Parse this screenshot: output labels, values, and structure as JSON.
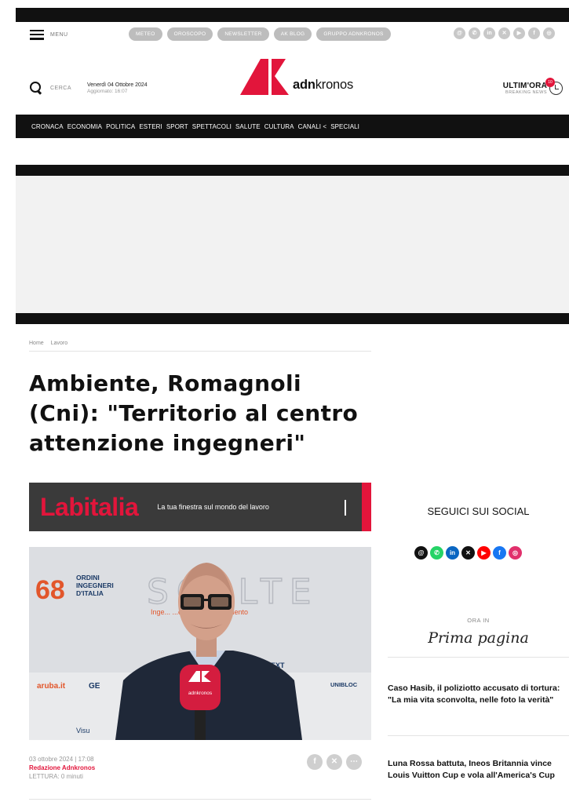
{
  "header": {
    "menu_label": "MENU",
    "pills": [
      "METEO",
      "OROSCOPO",
      "NEWSLETTER",
      "AK BLOG",
      "GRUPPO ADNKRONOS"
    ],
    "top_socials": [
      "threads-icon",
      "whatsapp-icon",
      "linkedin-icon",
      "x-icon",
      "youtube-icon",
      "facebook-icon",
      "instagram-icon"
    ],
    "search_label": "CERCA",
    "date": "Venerdì 04 Ottobre 2024",
    "updated": "Aggiornato: 16:07",
    "logo_prefix": "adn",
    "logo_suffix": "kronos",
    "ultimora_title": "ULTIM'ORA",
    "ultimora_sub": "BREAKING NEWS",
    "ultimora_badge": "10"
  },
  "nav": [
    "CRONACA",
    "ECONOMIA",
    "POLITICA",
    "ESTERI",
    "SPORT",
    "SPETTACOLI",
    "SALUTE",
    "CULTURA",
    "CANALI <",
    "SPECIALI"
  ],
  "article": {
    "breadcrumb": [
      "Home",
      "Lavoro"
    ],
    "title": "Ambiente, Romagnoli (Cni): \"Territorio al centro attenzione ingegneri\"",
    "banner_brand": "Labitalia",
    "banner_tagline": "La tua finestra sul mondo del lavoro",
    "photo_caption_bits": {
      "number": "68",
      "org1": "ORDINI",
      "org2": "INGEGNERI",
      "org3": "D'ITALIA",
      "backdrop_word": "SCELTE",
      "backdrop_line": "Inge... ...ernare il cambiamento",
      "sponsor1": "aruba.it",
      "sponsor2": "GE",
      "sponsor3": "...ON NEXT",
      "sponsor4": "UNIBLOC",
      "sponsor5": "Visu",
      "mic_label": "adnkronos"
    },
    "date": "03 ottobre 2024 | 17:08",
    "author": "Redazione Adnkronos",
    "reading": "LETTURA: 0 minuti",
    "share": [
      "facebook-share-icon",
      "x-share-icon",
      "more-share-icon"
    ]
  },
  "sidebar": {
    "social_title": "SEGUICI SUI SOCIAL",
    "socials": [
      {
        "name": "threads-icon",
        "color": "#111111"
      },
      {
        "name": "whatsapp-icon",
        "color": "#25d366"
      },
      {
        "name": "linkedin-icon",
        "color": "#0a66c2"
      },
      {
        "name": "x-icon",
        "color": "#111111"
      },
      {
        "name": "youtube-icon",
        "color": "#ff0000"
      },
      {
        "name": "facebook-icon",
        "color": "#1877f2"
      },
      {
        "name": "instagram-icon",
        "color": "#e1306c"
      }
    ],
    "ora_in": "ORA IN",
    "prima_pagina": "Prima pagina",
    "news": [
      "Caso Hasib, il poliziotto accusato di tortura: \"La mia vita sconvolta, nelle foto la verità\"",
      "Luna Rossa battuta, Ineos Britannia vince Louis Vuitton Cup e vola all'America's Cup"
    ]
  },
  "colors": {
    "accent": "#e2153b",
    "dark": "#111111"
  }
}
